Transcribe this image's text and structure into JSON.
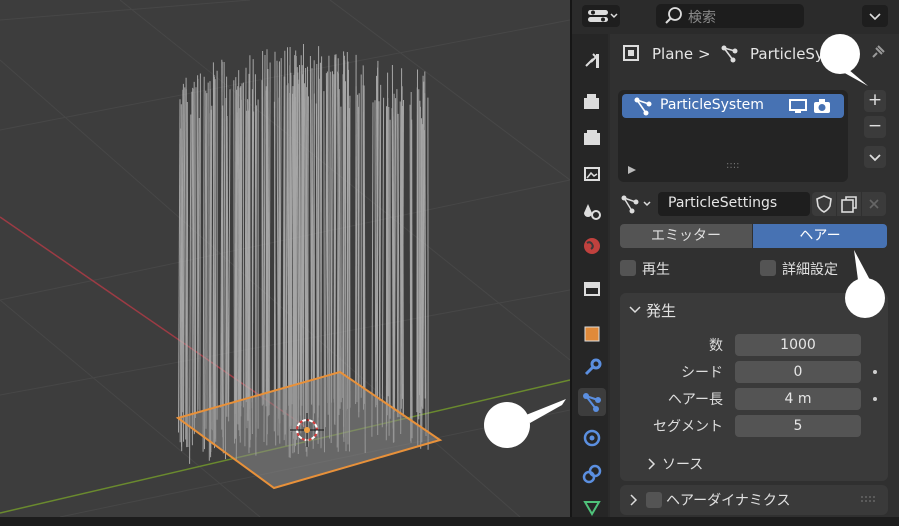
{
  "topbar": {
    "search_placeholder": "検索"
  },
  "breadcrumb": {
    "object": "Plane",
    "separator": ">",
    "particle": "ParticleSystem"
  },
  "particle_list": {
    "items": [
      {
        "label": "ParticleSystem"
      }
    ],
    "handle": "::::"
  },
  "settings": {
    "name": "ParticleSettings"
  },
  "type_toggle": {
    "options": [
      "エミッター",
      "ヘアー"
    ],
    "selected": "ヘアー"
  },
  "checkboxes": {
    "regrow": "再生",
    "advanced": "詳細設定"
  },
  "emission": {
    "title": "発生",
    "fields": [
      {
        "label": "数",
        "value": "1000"
      },
      {
        "label": "シード",
        "value": "0"
      },
      {
        "label": "ヘアー長",
        "value": "4 m"
      },
      {
        "label": "セグメント",
        "value": "5"
      }
    ],
    "source": "ソース"
  },
  "hair_dynamics": {
    "title": "ヘアーダイナミクス"
  },
  "colors": {
    "accent": "#4772b3",
    "selection_outline": "#e8913a",
    "grid_red": "#9c3b44",
    "grid_green": "#6a8a2e"
  }
}
